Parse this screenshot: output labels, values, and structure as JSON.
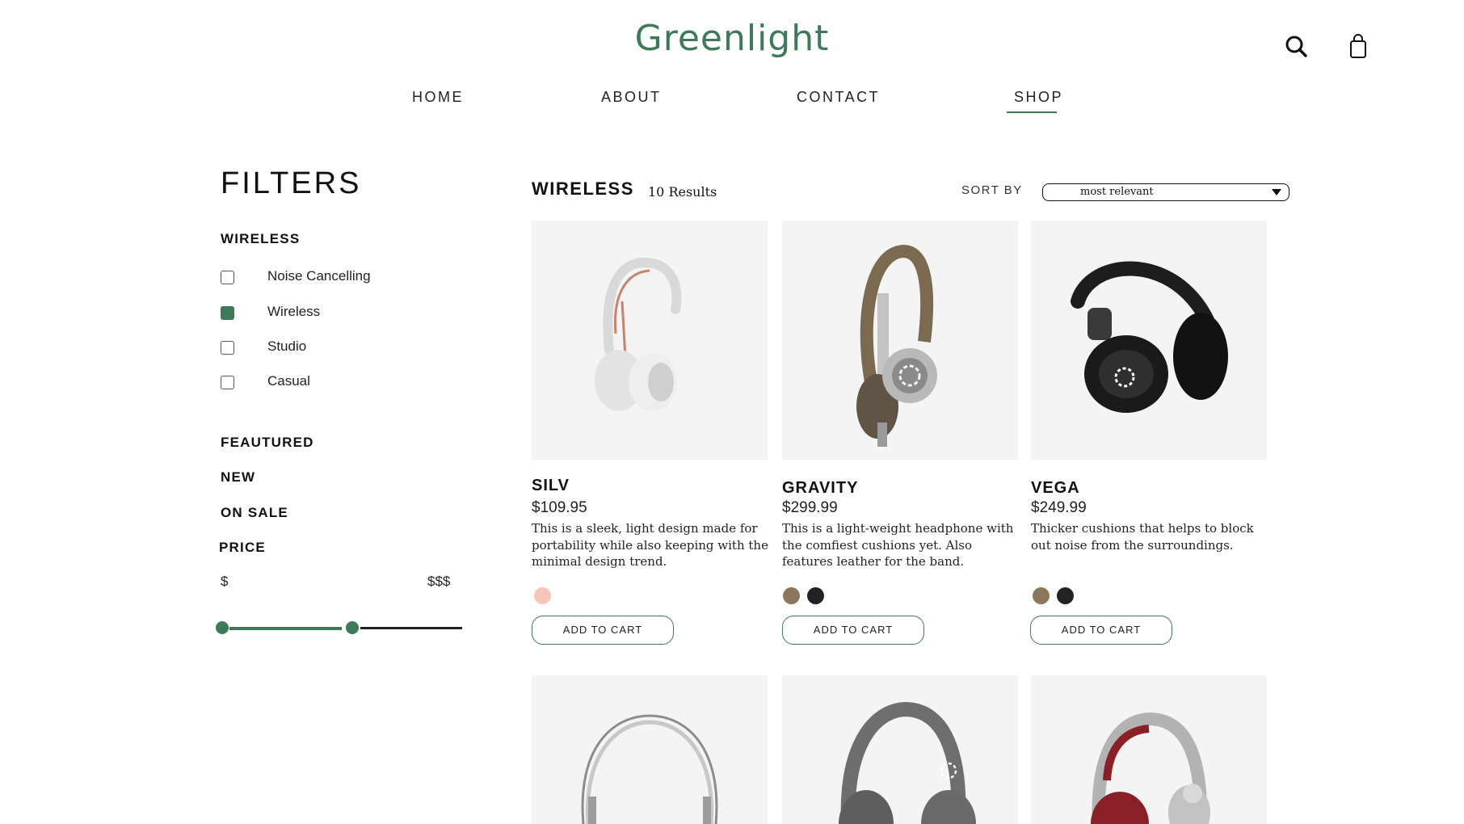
{
  "brand": {
    "logo_text": "Greenlight",
    "accent_color": "#3e7a58"
  },
  "header": {
    "search_icon": "search-icon",
    "cart_icon": "shopping-bag-icon"
  },
  "nav": {
    "items": [
      {
        "label": "HOME"
      },
      {
        "label": "ABOUT"
      },
      {
        "label": "CONTACT"
      },
      {
        "label": "SHOP",
        "active": true
      }
    ]
  },
  "filters": {
    "title": "FILTERS",
    "category_heading": "WIRELESS",
    "options": [
      {
        "label": "Noise Cancelling",
        "checked": false
      },
      {
        "label": "Wireless",
        "checked": true
      },
      {
        "label": "Studio",
        "checked": false
      },
      {
        "label": "Casual",
        "checked": false
      }
    ],
    "sections": [
      "FEAUTURED",
      "NEW",
      "ON SALE"
    ],
    "price": {
      "heading": "PRICE",
      "min_label": "$",
      "max_label": "$$$",
      "range_fraction": [
        0.0,
        0.5
      ]
    }
  },
  "results": {
    "category": "WIRELESS",
    "count_text": "10 Results",
    "sort_label": "SORT BY",
    "sort_value": "most relevant"
  },
  "products": [
    {
      "name": "SILV",
      "price": "$109.95",
      "description": "This is a sleek, light design made for portability while also keeping with the minimal design trend.",
      "swatches": [
        "#f7c6bb"
      ],
      "button": "ADD TO CART"
    },
    {
      "name": "GRAVITY",
      "price": "$299.99",
      "description": "This is a light-weight headphone with the comfiest cushions yet. Also features leather for the band.",
      "swatches": [
        "#8a775c",
        "#222222"
      ],
      "button": "ADD TO CART"
    },
    {
      "name": "VEGA",
      "price": "$249.99",
      "description": "Thicker cushions that helps to block out noise from the surroundings.",
      "swatches": [
        "#8a775c",
        "#222222"
      ],
      "button": "ADD TO CART"
    }
  ]
}
